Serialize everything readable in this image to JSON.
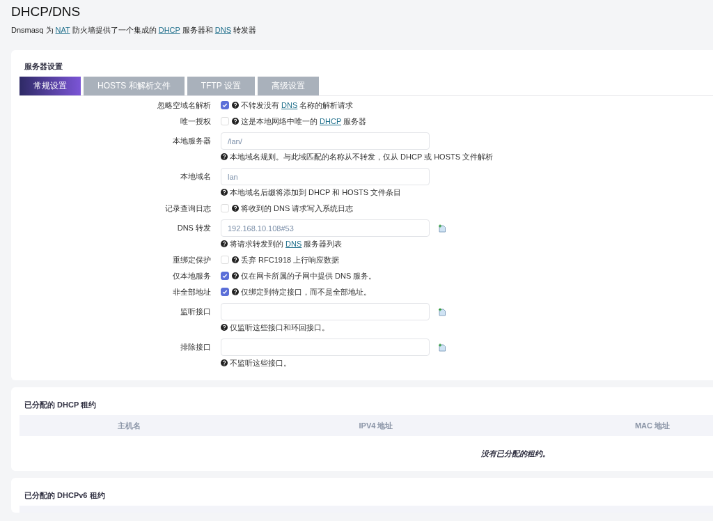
{
  "page": {
    "title": "DHCP/DNS",
    "description": [
      {
        "kind": "text",
        "text": "Dnsmasq 为 "
      },
      {
        "kind": "link",
        "text": "NAT"
      },
      {
        "kind": "text",
        "text": " 防火墙提供了一个集成的 "
      },
      {
        "kind": "link",
        "text": "DHCP"
      },
      {
        "kind": "text",
        "text": " 服务器和 "
      },
      {
        "kind": "link",
        "text": "DNS"
      },
      {
        "kind": "text",
        "text": " 转发器"
      }
    ]
  },
  "server_settings": {
    "title": "服务器设置",
    "tabs": [
      {
        "label": "常规设置",
        "selected": true
      },
      {
        "label": "HOSTS 和解析文件",
        "selected": false
      },
      {
        "label": "TFTP 设置",
        "selected": false
      },
      {
        "label": "高级设置",
        "selected": false
      }
    ],
    "fields": [
      {
        "kind": "checkbox",
        "label": "忽略空域名解析",
        "checked": true,
        "help": [
          {
            "kind": "text",
            "text": "不转发没有 "
          },
          {
            "kind": "link",
            "text": "DNS"
          },
          {
            "kind": "text",
            "text": " 名称的解析请求"
          }
        ]
      },
      {
        "kind": "checkbox",
        "label": "唯一授权",
        "checked": false,
        "help": [
          {
            "kind": "text",
            "text": "这是本地网络中唯一的 "
          },
          {
            "kind": "link",
            "text": "DHCP"
          },
          {
            "kind": "text",
            "text": " 服务器"
          }
        ]
      },
      {
        "kind": "input",
        "label": "本地服务器",
        "value": "/lan/",
        "addable": false,
        "help": [
          {
            "kind": "text",
            "text": "本地域名规则。与此域匹配的名称从不转发，仅从 DHCP 或 HOSTS 文件解析"
          }
        ]
      },
      {
        "kind": "input",
        "label": "本地域名",
        "value": "lan",
        "addable": false,
        "help": [
          {
            "kind": "text",
            "text": "本地域名后缀将添加到 DHCP 和 HOSTS 文件条目"
          }
        ]
      },
      {
        "kind": "checkbox",
        "label": "记录查询日志",
        "checked": false,
        "help": [
          {
            "kind": "text",
            "text": "将收到的 DNS 请求写入系统日志"
          }
        ]
      },
      {
        "kind": "input",
        "label": "DNS 转发",
        "value": "192.168.10.108#53",
        "addable": true,
        "help": [
          {
            "kind": "text",
            "text": "将请求转发到的 "
          },
          {
            "kind": "link",
            "text": "DNS"
          },
          {
            "kind": "text",
            "text": " 服务器列表"
          }
        ]
      },
      {
        "kind": "checkbox",
        "label": "重绑定保护",
        "checked": false,
        "help": [
          {
            "kind": "text",
            "text": "丢弃 RFC1918 上行响应数据"
          }
        ]
      },
      {
        "kind": "checkbox",
        "label": "仅本地服务",
        "checked": true,
        "help": [
          {
            "kind": "text",
            "text": "仅在网卡所属的子网中提供 DNS 服务。"
          }
        ]
      },
      {
        "kind": "checkbox",
        "label": "非全部地址",
        "checked": true,
        "help": [
          {
            "kind": "text",
            "text": "仅绑定到特定接口，而不是全部地址。"
          }
        ]
      },
      {
        "kind": "input",
        "label": "监听接口",
        "addable": true,
        "help": [
          {
            "kind": "text",
            "text": "仅监听这些接口和环回接口。"
          }
        ]
      },
      {
        "kind": "input",
        "label": "排除接口",
        "addable": true,
        "help": [
          {
            "kind": "text",
            "text": "不监听这些接口。"
          }
        ]
      }
    ]
  },
  "dhcp_leases": {
    "title": "已分配的 DHCP 租约",
    "columns": [
      "主机名",
      "IPV4 地址",
      "MAC 地址"
    ],
    "empty_message": "没有已分配的租约。"
  },
  "dhcpv6_leases": {
    "title": "已分配的 DHCPv6 租约"
  }
}
